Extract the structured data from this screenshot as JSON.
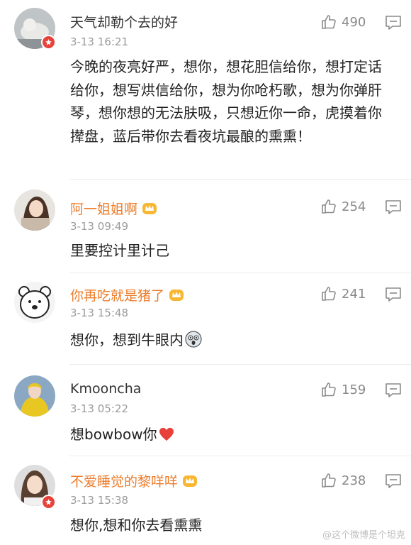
{
  "comments": [
    {
      "name": "天气却勒个去的好",
      "time": "3-13 16:21",
      "likes": "490",
      "text": "今晚的夜亮好严，想你，想花胆信给你，想打定话给你，想写烘信给你，想为你呛朽歌，想为你弹肝琴，想你想的无法肤吸，只想近你一命，虎摸着你撵盘，蓝后带你去看夜坑最酿的熏熏！",
      "name_color": "dark",
      "verified": true
    },
    {
      "name": "阿一姐姐啊",
      "time": "3-13 09:49",
      "likes": "254",
      "text": "里要控计里计己",
      "name_color": "orange",
      "verified": false
    },
    {
      "name": "你再吃就是猪了",
      "time": "3-13 15:48",
      "likes": "241",
      "text": "想你，想到牛眼内",
      "name_color": "orange",
      "verified": false
    },
    {
      "name": "Kmooncha",
      "time": "3-13 05:22",
      "likes": "159",
      "text": "想bowbow你",
      "name_color": "dark",
      "verified": false
    },
    {
      "name": "不爱睡觉的黎咩咩",
      "time": "3-13 15:38",
      "likes": "238",
      "text": "想你,想和你去看熏熏",
      "name_color": "orange",
      "verified": true
    }
  ],
  "watermark": "@这个微博是个坦克",
  "colors": {
    "accent_name": "#ec7d2c",
    "verified_badge": "#e8413a",
    "meta_gray": "#9b9b9b"
  },
  "icons": {
    "like": "thumbs-up-icon",
    "reply": "comment-icon",
    "vip": "crown-icon"
  }
}
